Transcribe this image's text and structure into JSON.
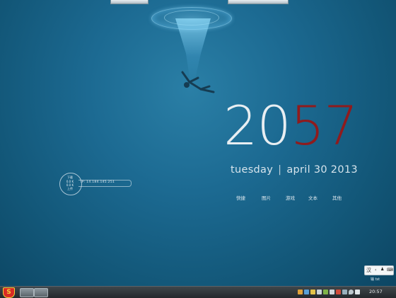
{
  "clock": {
    "hours": "20",
    "minutes": "57"
  },
  "date": {
    "day": "tuesday",
    "separator": "|",
    "full": "april 30 2013"
  },
  "quick_links": [
    "快捷",
    "图片",
    "游戏",
    "文本",
    "其他"
  ],
  "net_widget": {
    "download_label": "下载",
    "download_rate": "0.0 K",
    "upload_rate": "0.0 K",
    "upload_label": "上传",
    "ip_label": "IP: 14.184.145.251"
  },
  "input_method": {
    "lang": "汉",
    "label": "输 tst"
  },
  "taskbar": {
    "start_glyph": "S",
    "time": "20:57"
  },
  "colors": {
    "hours": "#e8eef2",
    "minutes": "#8f1b1d",
    "background": "#1c6a92"
  }
}
